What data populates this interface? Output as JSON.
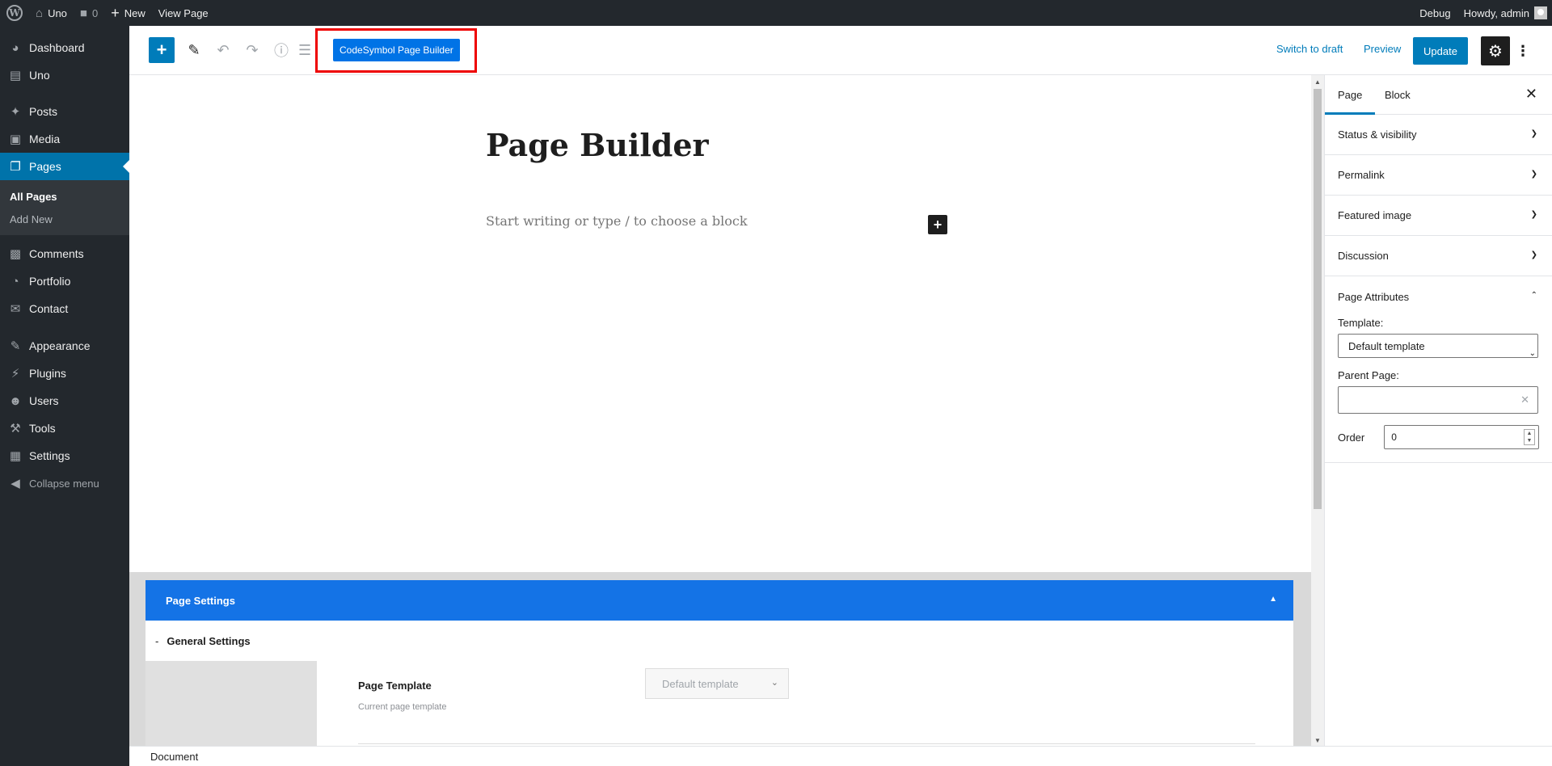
{
  "adminbar": {
    "site_name": "Uno",
    "comments_count": "0",
    "new_label": "New",
    "view_page_label": "View Page",
    "debug_label": "Debug",
    "howdy_label": "Howdy, admin"
  },
  "sidebar": {
    "items": [
      {
        "label": "Dashboard",
        "icon": "dashboard-icon"
      },
      {
        "label": "Uno",
        "icon": "uno-icon"
      },
      {
        "label": "Posts",
        "icon": "pin-icon"
      },
      {
        "label": "Media",
        "icon": "media-icon"
      },
      {
        "label": "Pages",
        "icon": "pages-icon"
      },
      {
        "label": "Comments",
        "icon": "comments-icon"
      },
      {
        "label": "Portfolio",
        "icon": "portfolio-icon"
      },
      {
        "label": "Contact",
        "icon": "mail-icon"
      },
      {
        "label": "Appearance",
        "icon": "brush-icon"
      },
      {
        "label": "Plugins",
        "icon": "plug-icon"
      },
      {
        "label": "Users",
        "icon": "user-icon"
      },
      {
        "label": "Tools",
        "icon": "wrench-icon"
      },
      {
        "label": "Settings",
        "icon": "settings-icon"
      },
      {
        "label": "Collapse menu",
        "icon": "collapse-icon"
      }
    ],
    "submenu": [
      "All Pages",
      "Add New"
    ]
  },
  "toolbar": {
    "codesymbol_label": "CodeSymbol Page Builder",
    "switch_draft_label": "Switch to draft",
    "preview_label": "Preview",
    "update_label": "Update"
  },
  "editor": {
    "title": "Page Builder",
    "placeholder": "Start writing or type / to choose a block"
  },
  "metabox": {
    "header": "Page Settings",
    "section": "General Settings",
    "template_label": "Page Template",
    "template_desc": "Current page template",
    "template_value": "Default template"
  },
  "footer": {
    "breadcrumb": "Document"
  },
  "settings_sidebar": {
    "tabs": [
      "Page",
      "Block"
    ],
    "panels": [
      "Status & visibility",
      "Permalink",
      "Featured image",
      "Discussion"
    ],
    "attributes": {
      "title": "Page Attributes",
      "template_label": "Template:",
      "template_value": "Default template",
      "parent_label": "Parent Page:",
      "parent_value": "",
      "order_label": "Order",
      "order_value": "0"
    }
  },
  "colors": {
    "admin_dark": "#23282d",
    "primary_blue": "#007cba",
    "meta_blue": "#1473e6",
    "highlight_red": "#e00000"
  }
}
